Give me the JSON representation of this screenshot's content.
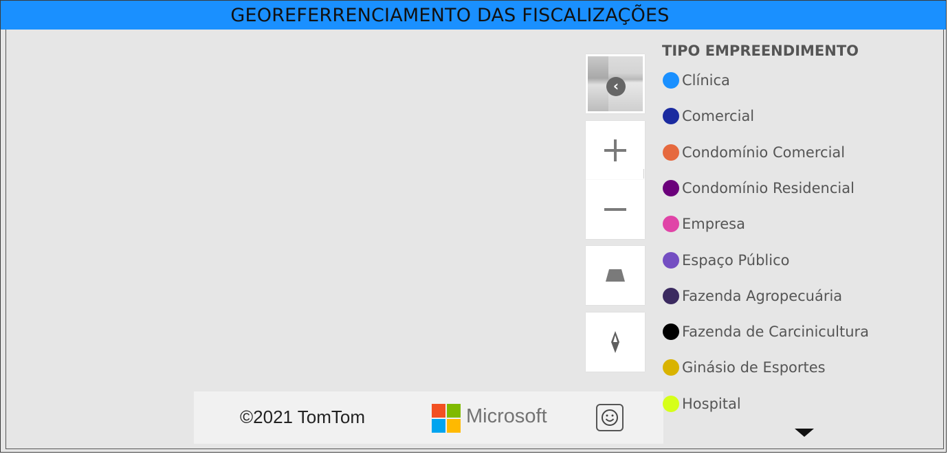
{
  "title": "GEOREFERRENCIAMENTO DAS FISCALIZAÇÕES",
  "map": {
    "attribution": "©2021 TomTom",
    "provider": "Microsoft",
    "controls": {
      "style_picker_icon": "chevron-left-icon",
      "zoom_in_icon": "plus-icon",
      "zoom_out_icon": "minus-icon",
      "pitch_icon": "pitch-trapezoid-icon",
      "compass_icon": "compass-icon",
      "feedback_icon": "smiley-icon"
    }
  },
  "legend": {
    "title": "TIPO EMPREENDIMENTO",
    "items": [
      {
        "label": "Clínica",
        "color": "#1a90ff"
      },
      {
        "label": "Comercial",
        "color": "#1b2ba0"
      },
      {
        "label": "Condomínio Comercial",
        "color": "#e6693e"
      },
      {
        "label": "Condomínio Residencial",
        "color": "#6b007b"
      },
      {
        "label": "Empresa",
        "color": "#e044a7"
      },
      {
        "label": "Espaço Público",
        "color": "#744ec2"
      },
      {
        "label": "Fazenda Agropecuária",
        "color": "#3b2a60"
      },
      {
        "label": "Fazenda de Carcinicultura",
        "color": "#000000"
      },
      {
        "label": "Ginásio de Esportes",
        "color": "#d9b300"
      },
      {
        "label": "Hospital",
        "color": "#d6ff1a"
      }
    ],
    "more_icon": "triangle-down-icon"
  }
}
